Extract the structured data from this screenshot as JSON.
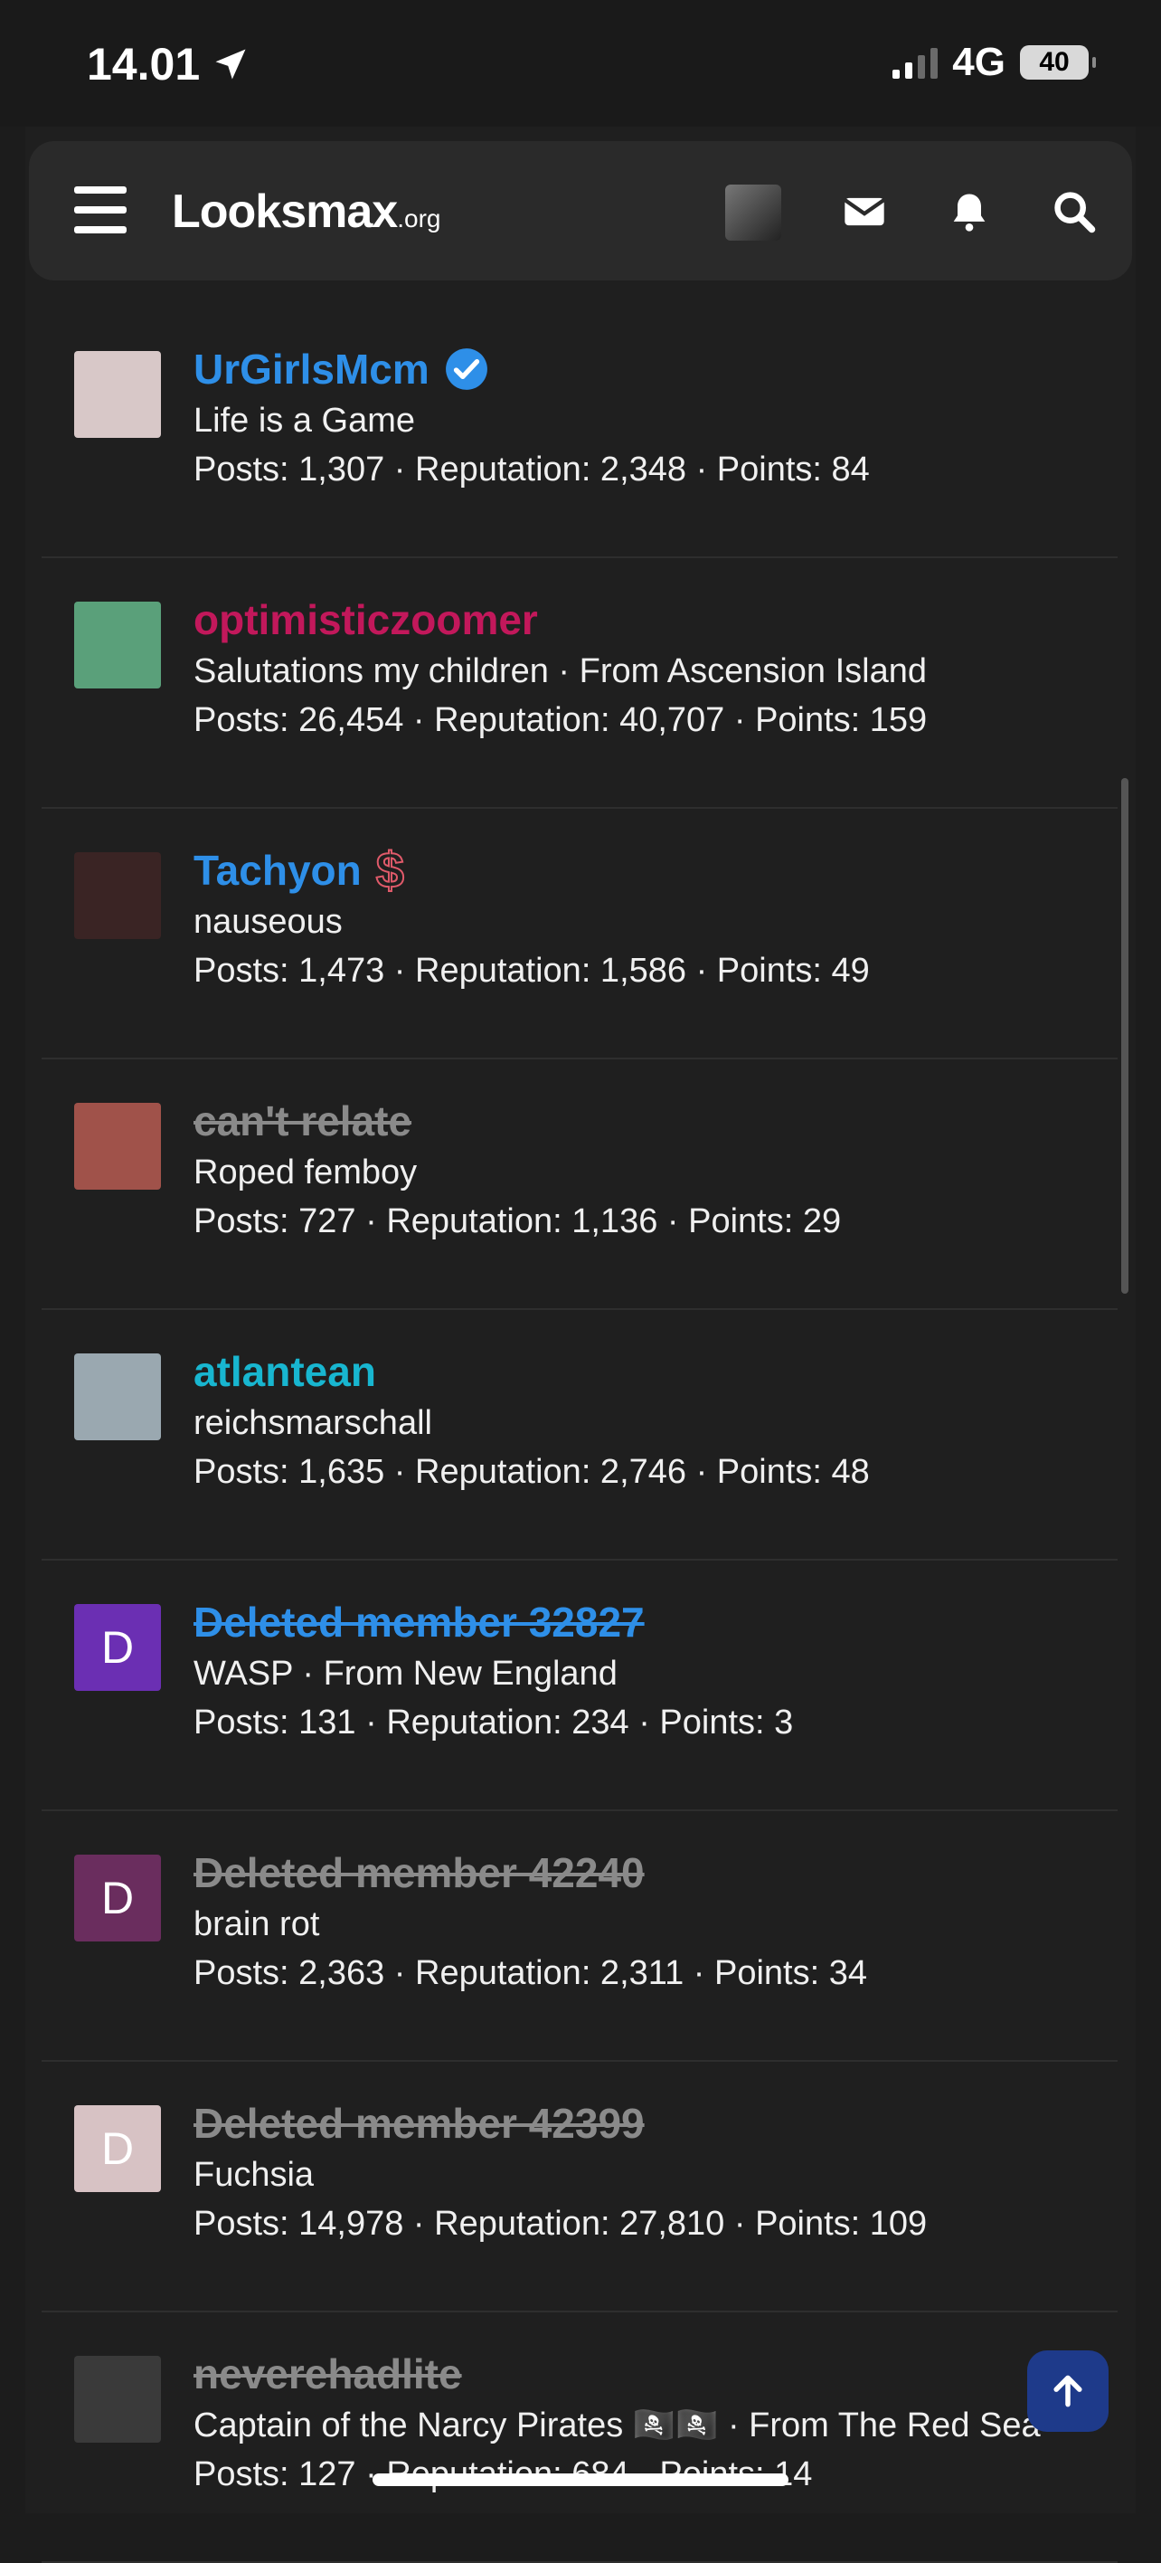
{
  "status_bar": {
    "time": "14.01",
    "network": "4G",
    "battery": "40"
  },
  "navbar": {
    "logo_main": "Looksmax",
    "logo_tld": ".org"
  },
  "members": [
    {
      "name": "UrGirlsMcm",
      "name_color": "#2e8fe8",
      "strike": false,
      "badge": "verified-check",
      "avatar_letter": "",
      "avatar_bg": "#d8c8c8",
      "title": "Life is a Game",
      "stats": "Posts: 1,307 · Reputation: 2,348 · Points: 84"
    },
    {
      "name": "optimisticzoomer",
      "name_color": "#c2185b",
      "strike": false,
      "badge": "",
      "avatar_letter": "",
      "avatar_bg": "#5aa07a",
      "title": "Salutations my children · From Ascension Island",
      "stats": "Posts: 26,454 · Reputation: 40,707 · Points: 159"
    },
    {
      "name": "Tachyon",
      "name_color": "#2e8fe8",
      "strike": false,
      "badge": "dollar",
      "badge_text": "$",
      "avatar_letter": "",
      "avatar_bg": "#3a2424",
      "title": "nauseous",
      "stats": "Posts: 1,473 · Reputation: 1,586 · Points: 49"
    },
    {
      "name": "can't relate",
      "name_color": "#8a8a8a",
      "strike": true,
      "badge": "",
      "avatar_letter": "",
      "avatar_bg": "#a0524a",
      "title": "Roped femboy",
      "stats": "Posts: 727 · Reputation: 1,136 · Points: 29"
    },
    {
      "name": "atlantean",
      "name_color": "#18b6d0",
      "strike": false,
      "badge": "",
      "avatar_letter": "",
      "avatar_bg": "#9aa8b0",
      "title": "reichsmarschall",
      "stats": "Posts: 1,635 · Reputation: 2,746 · Points: 48"
    },
    {
      "name": "Deleted member 32827",
      "name_color": "#2e8fe8",
      "strike": true,
      "badge": "",
      "avatar_letter": "D",
      "avatar_bg": "#6b2fb3",
      "title": "WASP · From New England",
      "stats": "Posts: 131 · Reputation: 234 · Points: 3"
    },
    {
      "name": "Deleted member 42240",
      "name_color": "#8a8a8a",
      "strike": true,
      "badge": "",
      "avatar_letter": "D",
      "avatar_bg": "#6a2d5e",
      "title": "brain rot",
      "stats": "Posts: 2,363 · Reputation: 2,311 · Points: 34"
    },
    {
      "name": "Deleted member 42399",
      "name_color": "#8a8a8a",
      "strike": true,
      "badge": "",
      "avatar_letter": "D",
      "avatar_bg": "#d7c2c4",
      "title": "Fuchsia",
      "stats": "Posts: 14,978 · Reputation: 27,810 · Points: 109"
    },
    {
      "name": "neverehadlite",
      "name_color": "#8a8a8a",
      "strike": true,
      "badge": "",
      "avatar_letter": "",
      "avatar_bg": "#3a3a3a",
      "title": "Captain of the Narcy Pirates 🏴‍☠️🏴‍☠️ · From The Red Sea",
      "stats": "Posts: 127 · Reputation: 684 · Points: 14"
    }
  ]
}
